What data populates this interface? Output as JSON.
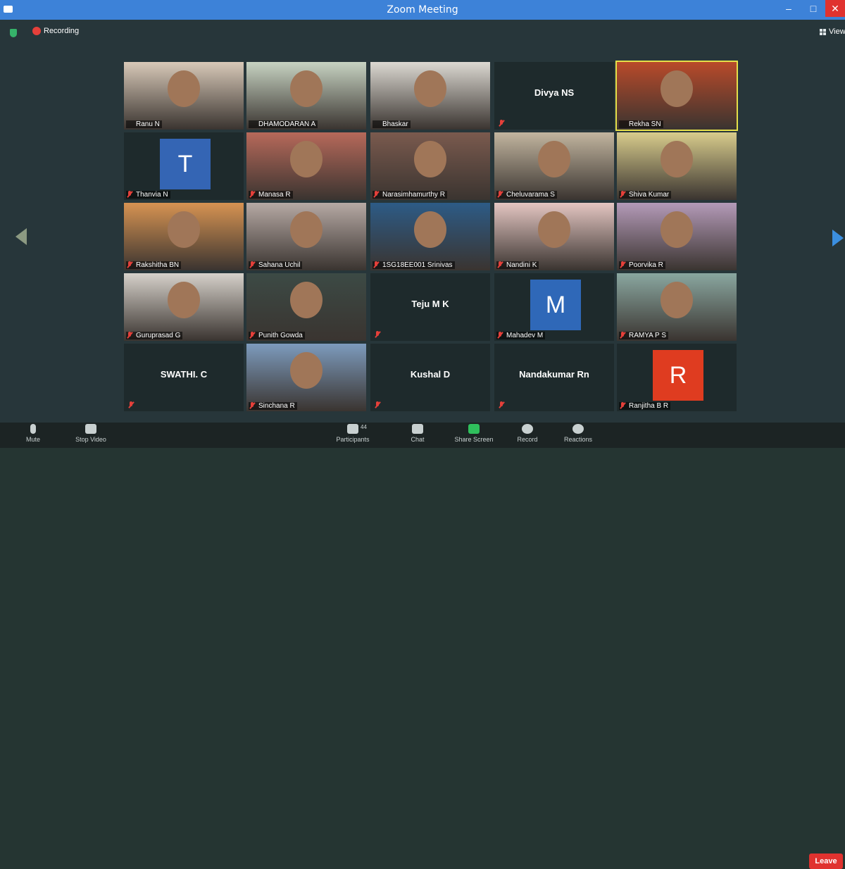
{
  "window": {
    "title": "Zoom Meeting",
    "minimize": "–",
    "maximize": "□",
    "close": "✕"
  },
  "topbar": {
    "recording_label": "Recording",
    "view_label": "View"
  },
  "participants": [
    {
      "name": "Ranu N",
      "mode": "video",
      "bg": "#d8c9b8",
      "muted": false
    },
    {
      "name": "DHAMODARAN A",
      "mode": "video",
      "bg": "#c7d3c2",
      "muted": false
    },
    {
      "name": "Bhaskar",
      "mode": "video",
      "bg": "#dcd9d2",
      "muted": false
    },
    {
      "name": "Divya NS",
      "mode": "name",
      "muted": true
    },
    {
      "name": "Rekha SN",
      "mode": "video",
      "bg": "#b94a2a",
      "muted": false,
      "active": true
    },
    {
      "name": "Thanvia N",
      "mode": "avatar",
      "letter": "T",
      "color": "#3465b4",
      "muted": true
    },
    {
      "name": "Manasa R",
      "mode": "video",
      "bg": "#b7695a",
      "muted": true
    },
    {
      "name": "Narasimhamurthy R",
      "mode": "video",
      "bg": "#7a5a4e",
      "muted": true
    },
    {
      "name": "Cheluvarama S",
      "mode": "video",
      "bg": "#c2b59f",
      "muted": true
    },
    {
      "name": "Shiva Kumar",
      "mode": "video",
      "bg": "#d8cc8c",
      "muted": true
    },
    {
      "name": "Rakshitha BN",
      "mode": "video",
      "bg": "#d79352",
      "muted": true
    },
    {
      "name": "Sahana Uchil",
      "mode": "video",
      "bg": "#b6a9a4",
      "muted": true
    },
    {
      "name": "1SG18EE001 Srinivas",
      "mode": "video",
      "bg": "#2d5b86",
      "muted": true
    },
    {
      "name": "Nandini K",
      "mode": "video",
      "bg": "#e4c6c2",
      "muted": true
    },
    {
      "name": "Poorvika R",
      "mode": "video",
      "bg": "#b49ab8",
      "muted": true
    },
    {
      "name": "Guruprasad G",
      "mode": "video",
      "bg": "#d6d1ca",
      "muted": true
    },
    {
      "name": "Punith Gowda",
      "mode": "video",
      "bg": "#3c4a45",
      "muted": true
    },
    {
      "name": "Teju M K",
      "mode": "name",
      "muted": true
    },
    {
      "name": "Mahadev M",
      "mode": "avatar",
      "letter": "M",
      "color": "#2f68b8",
      "muted": true
    },
    {
      "name": "RAMYA P S",
      "mode": "video",
      "bg": "#8aa7a0",
      "muted": true
    },
    {
      "name": "SWATHI. C",
      "mode": "name",
      "muted": true
    },
    {
      "name": "Sinchana R",
      "mode": "video",
      "bg": "#7d9bbd",
      "muted": true
    },
    {
      "name": "Kushal D",
      "mode": "name",
      "muted": true
    },
    {
      "name": "Nandakumar Rn",
      "mode": "name",
      "muted": true
    },
    {
      "name": "Ranjitha B R",
      "mode": "avatar",
      "letter": "R",
      "color": "#df3c20",
      "muted": true
    }
  ],
  "toolbar": {
    "mute": "Mute",
    "stop_video": "Stop Video",
    "participants": "Participants",
    "participant_count": "44",
    "chat": "Chat",
    "share_screen": "Share Screen",
    "record": "Record",
    "reactions": "Reactions",
    "leave": "Leave"
  }
}
